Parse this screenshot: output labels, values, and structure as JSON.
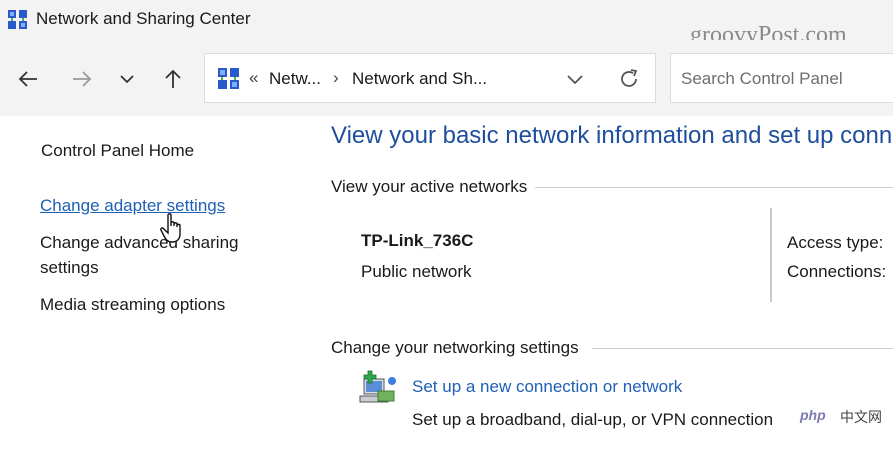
{
  "window": {
    "title": "Network and Sharing Center",
    "watermark": "groovyPost.com"
  },
  "navigation": {
    "back_icon": "arrow-left-icon",
    "forward_icon": "arrow-right-icon",
    "recent_icon": "chevron-down-icon",
    "up_icon": "arrow-up-icon"
  },
  "address": {
    "overflow": "«",
    "crumb1": "Netw...",
    "separator": "›",
    "crumb2": "Network and Sh...",
    "dropdown_icon": "chevron-down-icon",
    "refresh_icon": "refresh-icon"
  },
  "search": {
    "placeholder": "Search Control Panel"
  },
  "sidebar": {
    "home": "Control Panel Home",
    "items": [
      "Change adapter settings",
      "Change advanced sharing",
      "settings",
      "Media streaming options"
    ]
  },
  "main": {
    "heading": "View your basic network information and set up connections",
    "active_networks_title": "View your active networks",
    "network": {
      "name": "TP-Link_736C",
      "type": "Public network"
    },
    "properties": {
      "access_type_label": "Access type:",
      "connections_label": "Connections:"
    },
    "change_settings_title": "Change your networking settings",
    "setup": {
      "link": "Set up a new connection or network",
      "description": "Set up a broadband, dial-up, or VPN connection"
    }
  },
  "badge": {
    "php": "php",
    "zh": "中文网"
  },
  "colors": {
    "link": "#1f5fb5",
    "heading": "#1e4e9c",
    "chrome": "#f3f3f3"
  }
}
